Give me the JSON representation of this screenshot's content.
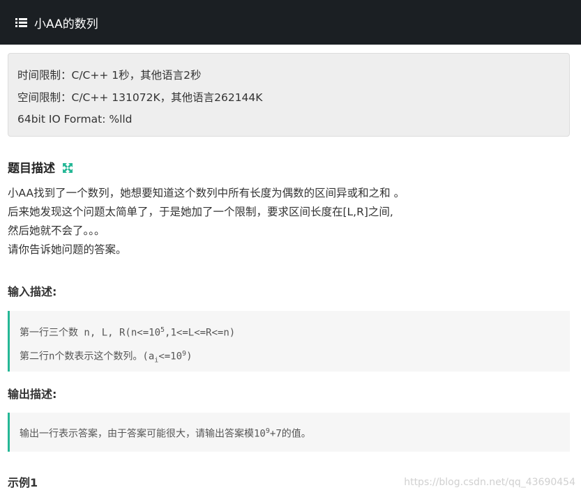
{
  "header": {
    "title": "小AA的数列",
    "icon": "list-icon"
  },
  "limits": {
    "time": "时间限制：C/C++ 1秒，其他语言2秒",
    "space": "空间限制：C/C++ 131072K，其他语言262144K",
    "io": "64bit IO Format: %lld"
  },
  "description": {
    "title": "题目描述",
    "lines": [
      "小AA找到了一个数列，她想要知道这个数列中所有长度为偶数的区间异或和之和 。",
      "后来她发现这个问题太简单了，于是她加了一个限制，要求区间长度在[L,R]之间,",
      "然后她就不会了。。。",
      "请你告诉她问题的答案。"
    ]
  },
  "input": {
    "title": "输入描述:",
    "line1_prefix": "第一行三个数 n, L, R(n<=10",
    "line1_sup": "5",
    "line1_suffix": ",1<=L<=R<=n)",
    "line2_prefix": "第二行n个数表示这个数列。(a",
    "line2_sub": "i",
    "line2_mid": "<=10",
    "line2_sup": "9",
    "line2_suffix": ")"
  },
  "output": {
    "title": "输出描述:",
    "prefix": "输出一行表示答案，由于答案可能很大，请输出答案模10",
    "sup": "9",
    "suffix": "+7的值。"
  },
  "example": {
    "title": "示例1"
  },
  "watermark": "https://blog.csdn.net/qq_43690454",
  "colors": {
    "accent": "#25b796",
    "header_bg": "#1b1f23"
  }
}
